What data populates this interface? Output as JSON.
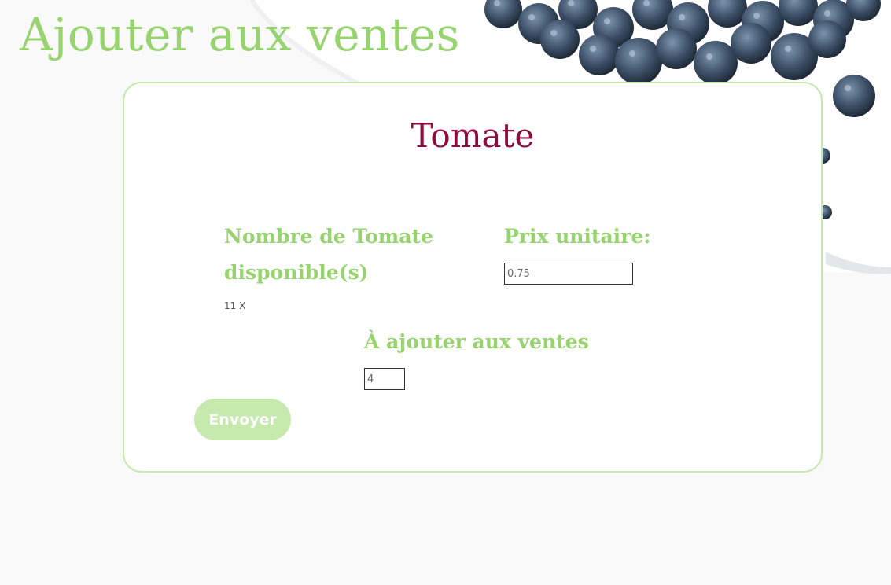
{
  "page": {
    "title": "Ajouter aux ventes"
  },
  "product": {
    "name": "Tomate",
    "stock_label": "Nombre de Tomate disponible(s)",
    "stock_value": "11 X",
    "price_label": "Prix unitaire:",
    "price_value": "0.75",
    "add_label": "À ajouter aux ventes",
    "add_value": "4"
  },
  "form": {
    "submit_label": "Envoyer"
  },
  "colors": {
    "accent_green": "#97d36f",
    "light_green": "#c6e9ad",
    "product_name": "#8e0b3f"
  },
  "background": {
    "icon": "blueberries-plate-image"
  }
}
